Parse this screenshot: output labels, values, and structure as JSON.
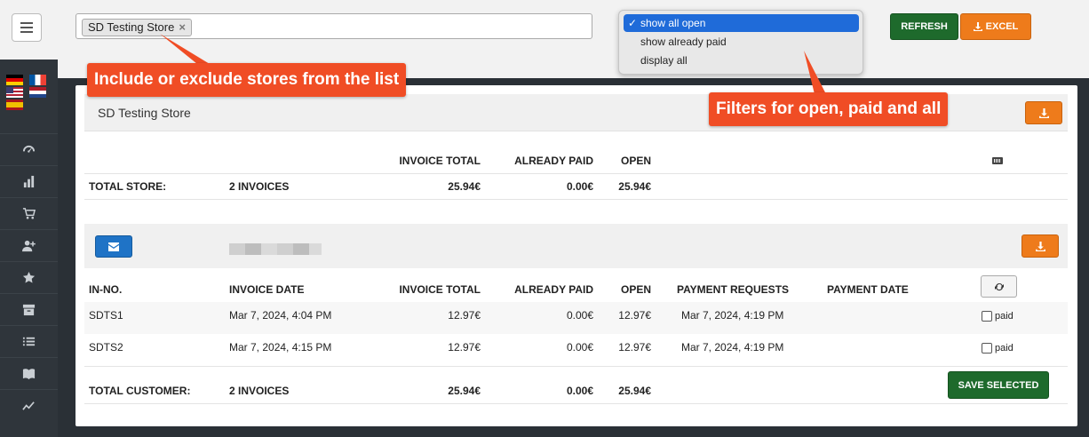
{
  "sidebar": {
    "menu_icon": "hamburger-icon",
    "flags": [
      "de",
      "fr",
      "us",
      "nl",
      "es"
    ],
    "nav_icons": [
      "dashboard-icon",
      "chart-icon",
      "cart-icon",
      "add-user-icon",
      "star-icon",
      "archive-icon",
      "list-icon",
      "book-icon",
      "trend-icon"
    ]
  },
  "topbar": {
    "store_tag": "SD Testing Store",
    "store_tag_remove": "×",
    "dropdown": {
      "check": "✓",
      "options": [
        "show all open",
        "show already paid",
        "display all"
      ],
      "selected_index": 0
    },
    "refresh_label": "REFRESH",
    "excel_label": "EXCEL"
  },
  "callouts": {
    "stores": "Include or exclude stores from the list",
    "filters": "Filters for open, paid and all"
  },
  "store_section": {
    "name": "SD Testing Store",
    "headers": {
      "invoice_total": "INVOICE TOTAL",
      "already_paid": "ALREADY PAID",
      "open": "OPEN"
    },
    "total_row": {
      "label": "TOTAL STORE:",
      "count": "2 INVOICES",
      "invoice_total": "25.94€",
      "already_paid": "0.00€",
      "open": "25.94€"
    }
  },
  "customer_section": {
    "headers": {
      "in_no": "IN-NO.",
      "invoice_date": "INVOICE DATE",
      "invoice_total": "INVOICE TOTAL",
      "already_paid": "ALREADY PAID",
      "open": "OPEN",
      "payment_requests": "PAYMENT REQUESTS",
      "payment_date": "PAYMENT DATE"
    },
    "rows": [
      {
        "in_no": "SDTS1",
        "invoice_date": "Mar 7, 2024, 4:04 PM",
        "invoice_total": "12.97€",
        "already_paid": "0.00€",
        "open": "12.97€",
        "payment_requests": "Mar 7, 2024, 4:19 PM",
        "payment_date": "",
        "paid_label": "paid"
      },
      {
        "in_no": "SDTS2",
        "invoice_date": "Mar 7, 2024, 4:15 PM",
        "invoice_total": "12.97€",
        "already_paid": "0.00€",
        "open": "12.97€",
        "payment_requests": "Mar 7, 2024, 4:19 PM",
        "payment_date": "",
        "paid_label": "paid"
      }
    ],
    "total_row": {
      "label": "TOTAL CUSTOMER:",
      "count": "2 INVOICES",
      "invoice_total": "25.94€",
      "already_paid": "0.00€",
      "open": "25.94€"
    },
    "save_label": "SAVE SELECTED"
  },
  "colors": {
    "refresh": "#1e6a2c",
    "excel": "#ee7b1b",
    "mail": "#1f73c6",
    "callout": "#f04d25",
    "dropdown_selected": "#1f6bd9"
  }
}
